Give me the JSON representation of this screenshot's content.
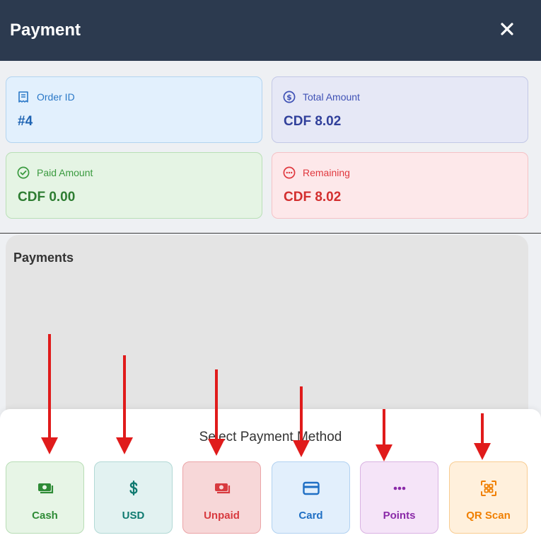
{
  "header": {
    "title": "Payment"
  },
  "summary": {
    "order": {
      "label": "Order ID",
      "value": "#4"
    },
    "total": {
      "label": "Total Amount",
      "value": "CDF 8.02"
    },
    "paid": {
      "label": "Paid Amount",
      "value": "CDF 0.00"
    },
    "remaining": {
      "label": "Remaining",
      "value": "CDF 8.02"
    }
  },
  "payments": {
    "title": "Payments"
  },
  "methods": {
    "title": "Select Payment Method",
    "items": [
      {
        "label": "Cash",
        "icon": "cash-icon"
      },
      {
        "label": "USD",
        "icon": "dollar-icon"
      },
      {
        "label": "Unpaid",
        "icon": "unpaid-icon"
      },
      {
        "label": "Card",
        "icon": "credit-card-icon"
      },
      {
        "label": "Points",
        "icon": "dots-icon"
      },
      {
        "label": "QR Scan",
        "icon": "qr-scan-icon"
      }
    ]
  },
  "colors": {
    "header_bg": "#2c3a4f",
    "annotation_arrow": "#e01b1b"
  }
}
